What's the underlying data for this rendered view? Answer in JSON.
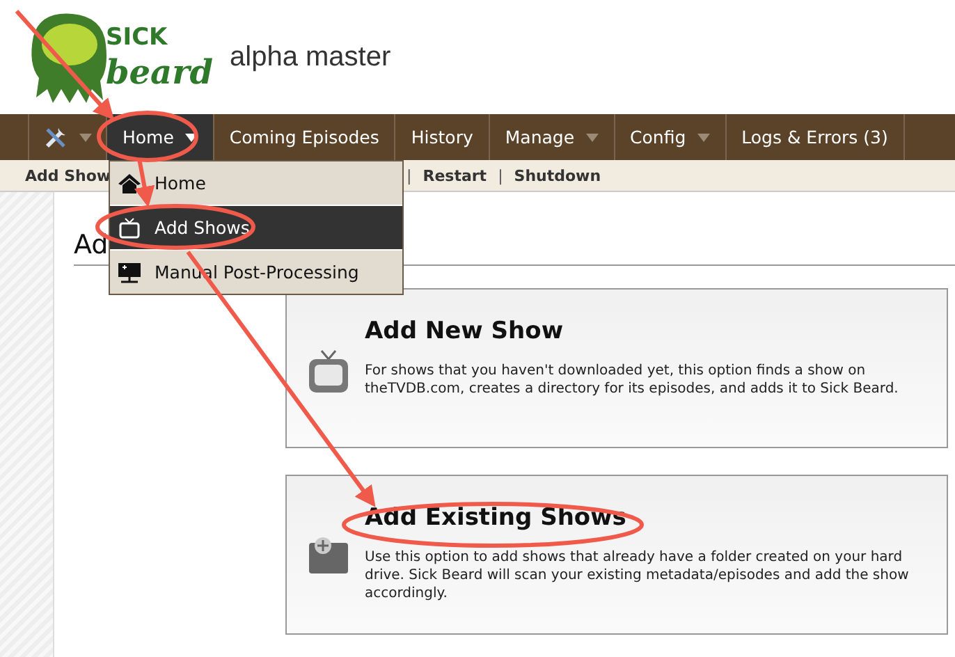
{
  "logo": {
    "word_top": "SICK",
    "word_bottom": "beard"
  },
  "site_subtitle": "alpha master",
  "nav": [
    {
      "kind": "tools",
      "dropdown": true,
      "selected": false
    },
    {
      "kind": "text",
      "label": "Home",
      "dropdown": true,
      "selected": true
    },
    {
      "kind": "text",
      "label": "Coming Episodes",
      "dropdown": false,
      "selected": false
    },
    {
      "kind": "text",
      "label": "History",
      "dropdown": false,
      "selected": false
    },
    {
      "kind": "text",
      "label": "Manage",
      "dropdown": true,
      "selected": false
    },
    {
      "kind": "text",
      "label": "Config",
      "dropdown": true,
      "selected": false
    },
    {
      "kind": "text",
      "label": "Logs & Errors (3)",
      "dropdown": false,
      "selected": false
    }
  ],
  "subnav": [
    "Add Show",
    "|",
    "Restart",
    "|",
    "Shutdown"
  ],
  "dropdown_menu": [
    {
      "label": "Home",
      "selected": false
    },
    {
      "label": "Add Shows",
      "selected": true
    },
    {
      "label": "Manual Post-Processing",
      "selected": false
    }
  ],
  "page_heading": "Ad",
  "options": [
    {
      "title": "Add New Show",
      "description": "For shows that you haven't downloaded yet, this option finds a show on theTVDB.com, creates a directory for its episodes, and adds it to Sick Beard."
    },
    {
      "title": "Add Existing Shows",
      "description": "Use this option to add shows that already have a folder created on your hard drive. Sick Beard will scan your existing metadata/episodes and add the show accordingly."
    }
  ]
}
